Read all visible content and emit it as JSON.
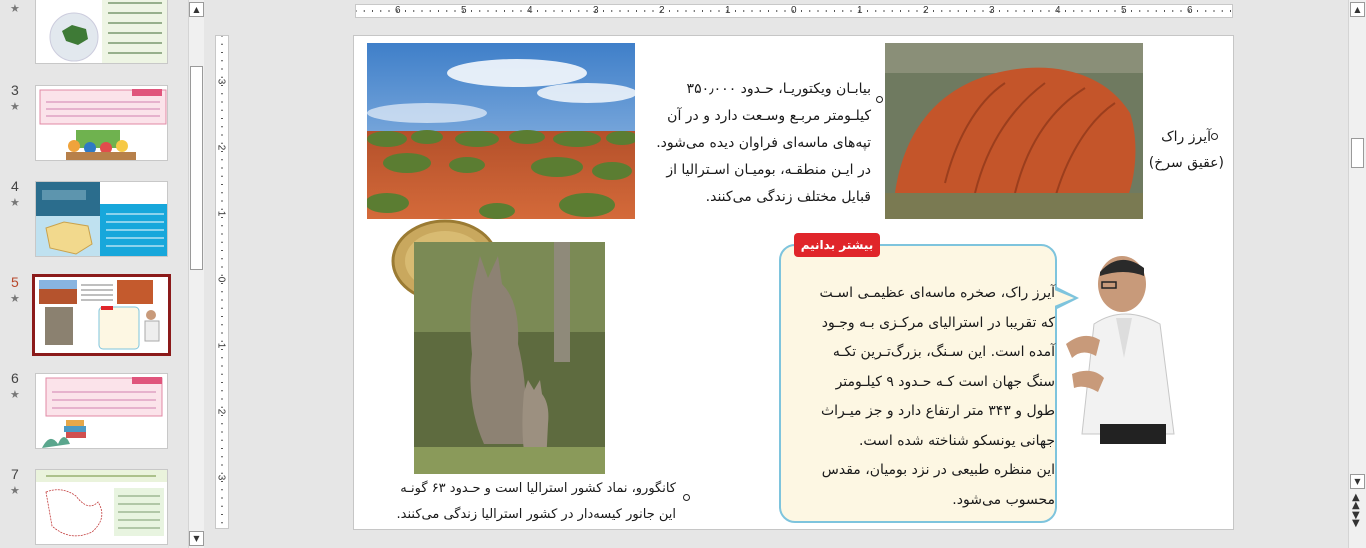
{
  "thumbnails": [
    {
      "number": "",
      "star": "★"
    },
    {
      "number": "3",
      "star": "★",
      "heading": "همانند"
    },
    {
      "number": "4",
      "star": "★",
      "heading": "ویژگی‌های طبیعی"
    },
    {
      "number": "5",
      "star": "★"
    },
    {
      "number": "6",
      "star": "★",
      "heading": "همانند"
    },
    {
      "number": "7",
      "star": "★",
      "heading": "کشورها، شماره ۸ — نقشه جمعیت..."
    }
  ],
  "rulers": {
    "horizontal": [
      "6",
      "5",
      "4",
      "3",
      "2",
      "1",
      "0",
      "1",
      "2",
      "3",
      "4",
      "5",
      "6"
    ],
    "vertical": [
      "3",
      "2",
      "1",
      "0",
      "1",
      "2",
      "3"
    ]
  },
  "slide": {
    "ayers_label_line1": "آیرز راک",
    "ayers_label_line2": "(عقیق سرخ)",
    "victoria_lines": [
      "بیابـان ویکتوریـا، حـدود ۳۵۰٫۰۰۰",
      "کیلـومتر مربـع وسـعت دارد و در آن",
      "تپه‌های ماسه‌ای فراوان دیده می‌شود.",
      "در ایـن منطقـه، بومیـان اسـترالیا از",
      "قبایل مختلف زندگی می‌کنند."
    ],
    "know_more_badge": "بیشتر بدانیم",
    "callout_lines": [
      "آیرز راک، صخره ماسه‌ای عظیمـی اسـت",
      "که تقریبا در استرالیای مرکـزی بـه وجـود",
      "آمده است. این سـنگ، بزرگ‌تـرین تکـه",
      "سنگ جهان است کـه حـدود ۹ کیلـومتر",
      "طول و ۳۴۳ متر ارتفاع دارد و جز میـراث",
      "جهانی یونسکو شناخته شده است.",
      "این منظره طبیعی در نزد بومیان، مقدس",
      "محسوب می‌شود."
    ],
    "kangaroo_lines": [
      "کانگورو، نماد کشور استرالیا است و حـدود ۶۳ گونـه",
      "این جانور کیسه‌دار در کشور استرالیا زندگی می‌کنند."
    ]
  },
  "colors": {
    "accent_active": "#8b1a1a",
    "badge_red": "#e0252a",
    "callout_bg": "#fdf7e3",
    "callout_border": "#7ec4dd"
  }
}
